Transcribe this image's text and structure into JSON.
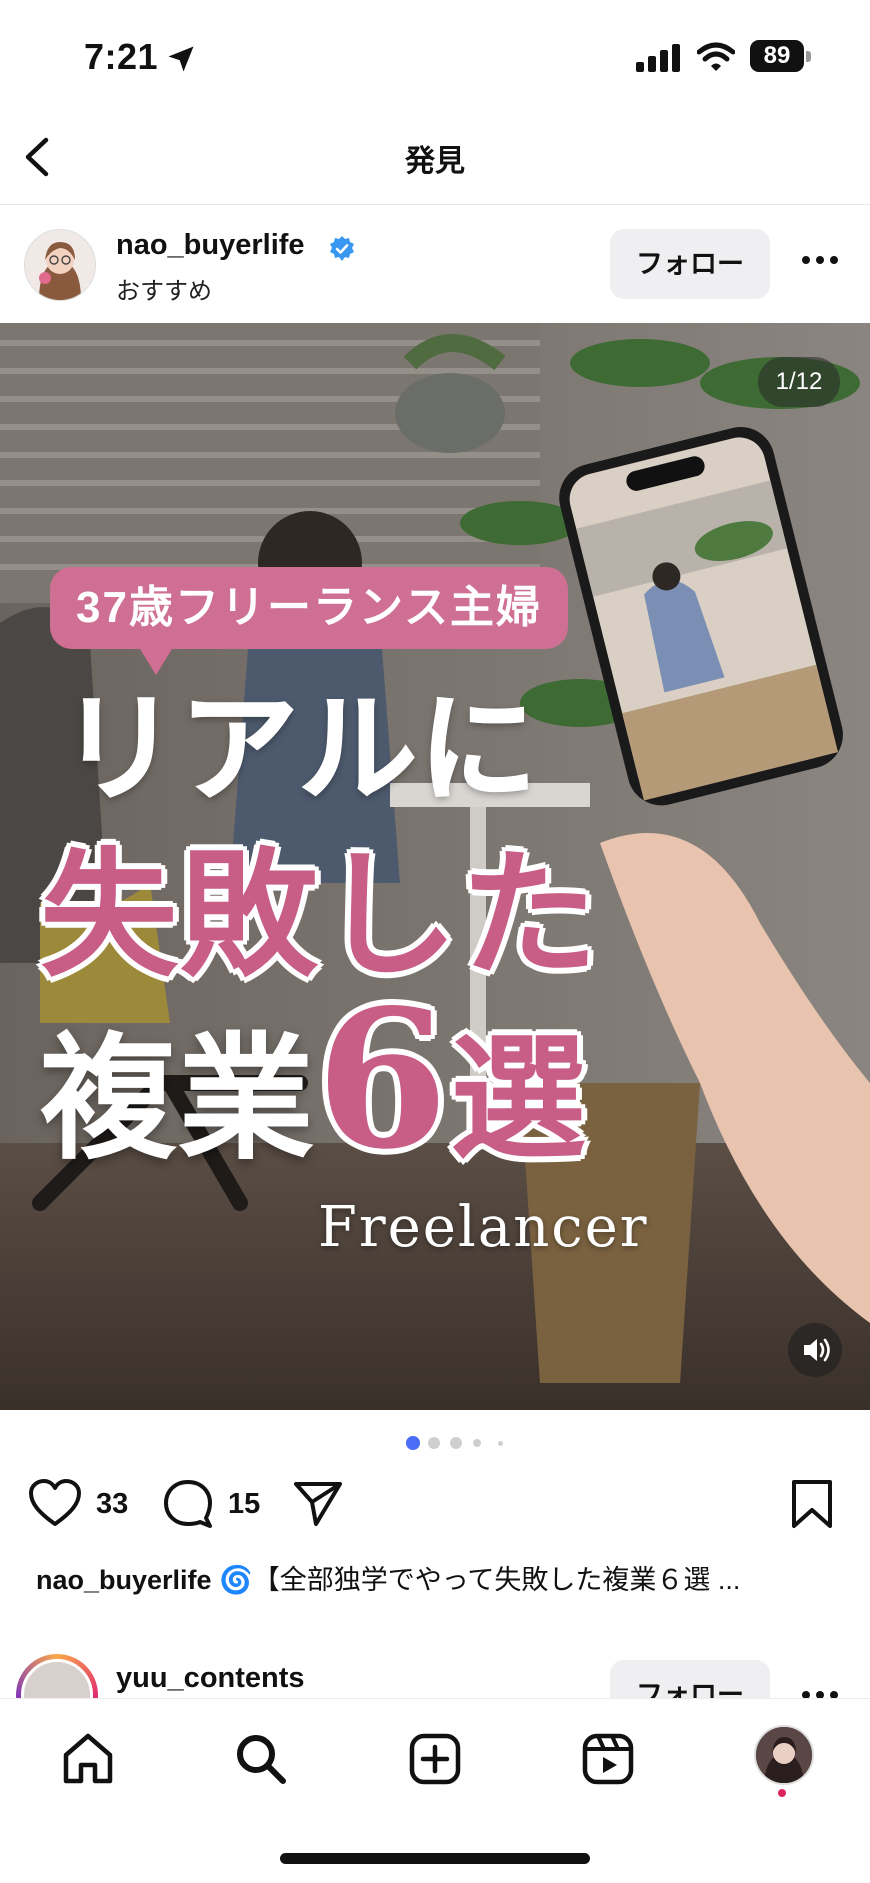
{
  "status_bar": {
    "time": "7:21",
    "battery": "89"
  },
  "nav": {
    "title": "発見"
  },
  "post": {
    "username": "nao_buyerlife",
    "subtitle": "おすすめ",
    "follow_label": "フォロー",
    "counter": "1/12",
    "image_text": {
      "tag": "37歳フリーランス主婦",
      "line1": "リアルに",
      "line2": "失敗した",
      "line3_a": "複業",
      "line3_num": "6",
      "line3_b": "選",
      "english": "Freelancer"
    },
    "likes": "33",
    "comments": "15",
    "caption_user": "nao_buyerlife",
    "caption_text": "🌀【全部独学でやって失敗した複業６選 ..."
  },
  "next_post": {
    "username": "yuu_contents",
    "follow_label": "フォロー"
  },
  "tabs": [
    "home-icon",
    "search-icon",
    "create-icon",
    "reels-icon",
    "profile-avatar"
  ],
  "colors": {
    "accent_pink": "#cf6f94",
    "active_dot": "#4a6cf7",
    "verified": "#3897f0"
  }
}
